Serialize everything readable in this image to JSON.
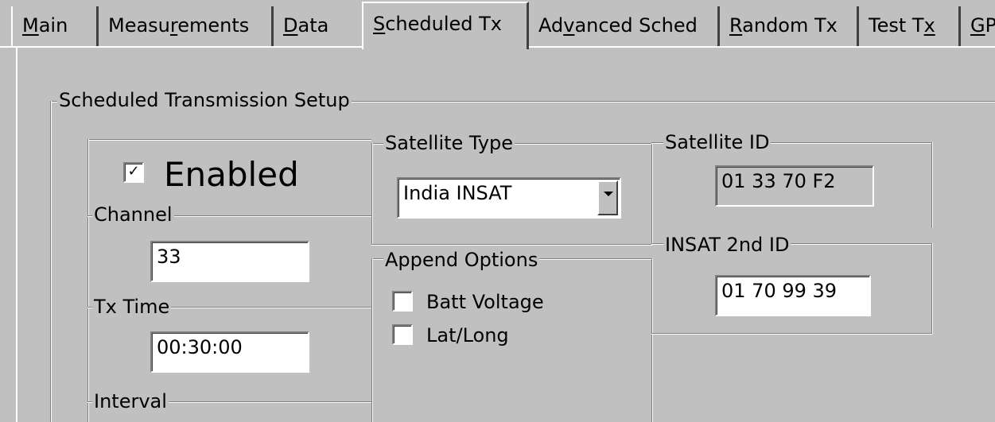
{
  "tabs": [
    {
      "label_pre": "",
      "label_u": "M",
      "label_post": "ain"
    },
    {
      "label_pre": "Measu",
      "label_u": "r",
      "label_post": "ements"
    },
    {
      "label_pre": "",
      "label_u": "D",
      "label_post": "ata"
    },
    {
      "label_pre": "",
      "label_u": "S",
      "label_post": "cheduled Tx"
    },
    {
      "label_pre": "Ad",
      "label_u": "v",
      "label_post": "anced Sched"
    },
    {
      "label_pre": "",
      "label_u": "R",
      "label_post": "andom Tx"
    },
    {
      "label_pre": "Test T",
      "label_u": "x",
      "label_post": ""
    },
    {
      "label_pre": "",
      "label_u": "G",
      "label_post": "P"
    }
  ],
  "setup": {
    "title": "Scheduled Transmission Setup",
    "enabled_label": "Enabled",
    "enabled_checked": true,
    "channel": {
      "title": "Channel",
      "value": "33"
    },
    "tx_time": {
      "title": "Tx Time",
      "value": "00:30:00"
    },
    "interval": {
      "title": "Interval"
    },
    "satellite_type": {
      "title": "Satellite Type",
      "selected": "India INSAT"
    },
    "append_options": {
      "title": "Append Options",
      "items": [
        {
          "label": "Batt Voltage",
          "checked": false
        },
        {
          "label": "Lat/Long",
          "checked": false
        }
      ]
    },
    "satellite_id": {
      "title": "Satellite ID",
      "value": "01 33 70 F2"
    },
    "insat_2nd_id": {
      "title": "INSAT 2nd ID",
      "value": "01 70 99 39"
    }
  },
  "colors": {
    "face": "#c0c0c0",
    "shadow": "#808080",
    "highlight": "#ffffff"
  }
}
